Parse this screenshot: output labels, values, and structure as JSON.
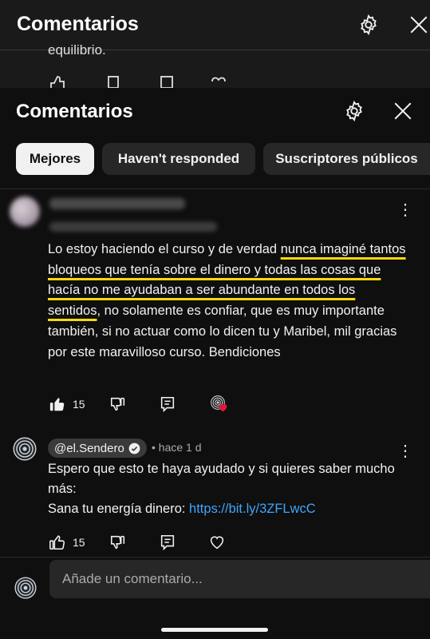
{
  "background_panel": {
    "title": "Comentarios",
    "snippet": "equilibrio."
  },
  "header": {
    "title": "Comentarios"
  },
  "chips": [
    {
      "label": "Mejores",
      "active": true
    },
    {
      "label": "Haven't responded",
      "active": false
    },
    {
      "label": "Suscriptores públicos",
      "active": false
    }
  ],
  "comment1": {
    "text_before": "Lo estoy haciendo el curso y de verdad ",
    "text_highlight": "nunca imaginé tantos bloqueos que tenía sobre el dinero y todas las cosas que hacía no me ayudaban a ser abundante en todos los sentidos",
    "text_after": ", no solamente es confiar, que es muy importante también, si no actuar como lo dicen tu y Maribel, mil gracias por este maravilloso curso. Bendiciones",
    "likes": "15",
    "highlight_color": "#f5d90a"
  },
  "comment2": {
    "handle": "@el.Sendero",
    "time": "• hace 1 d",
    "line1": "Espero que esto te haya ayudado y si quieres saber mucho más:",
    "line2_prefix": "Sana tu energía dinero: ",
    "link": "https://bit.ly/3ZFLwcC",
    "likes": "15"
  },
  "composer": {
    "placeholder": "Añade un comentario..."
  },
  "colors": {
    "background": "#0f0f0f",
    "chip_active": "#f1f1f1",
    "chip_idle": "#272727",
    "link": "#3ea6ff",
    "heart_badge": "#e3173e"
  }
}
